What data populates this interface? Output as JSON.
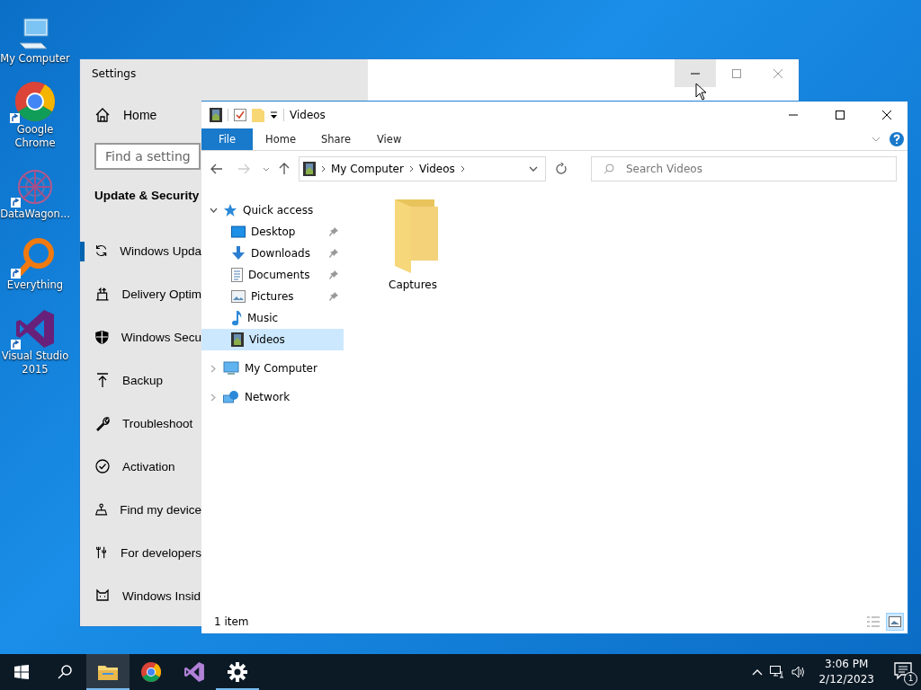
{
  "desktop_icons": [
    {
      "label": "My Computer",
      "kind": "computer",
      "shortcut": false
    },
    {
      "label": "Google Chrome",
      "kind": "chrome",
      "shortcut": true
    },
    {
      "label": "DataWagon...",
      "kind": "datawagon",
      "shortcut": true
    },
    {
      "label": "Everything",
      "kind": "everything",
      "shortcut": true
    },
    {
      "label": "Visual Studio 2015",
      "kind": "vs",
      "shortcut": true
    }
  ],
  "settings": {
    "title": "Settings",
    "minimize_hovered": true,
    "home": "Home",
    "search": {
      "placeholder": "Find a setting"
    },
    "section": "Update & Security",
    "items": [
      {
        "label": "Windows Upda",
        "kind": "sync",
        "selected": true
      },
      {
        "label": "Delivery Optim",
        "kind": "delivery",
        "selected": false
      },
      {
        "label": "Windows Secu",
        "kind": "shield",
        "selected": false
      },
      {
        "label": "Backup",
        "kind": "backup",
        "selected": false
      },
      {
        "label": "Troubleshoot",
        "kind": "wrench",
        "selected": false
      },
      {
        "label": "Activation",
        "kind": "check",
        "selected": false
      },
      {
        "label": "Find my device",
        "kind": "find",
        "selected": false
      },
      {
        "label": "For developers",
        "kind": "dev",
        "selected": false
      },
      {
        "label": "Windows Insid",
        "kind": "insider",
        "selected": false
      }
    ]
  },
  "explorer": {
    "title": "Videos",
    "ribbon_tabs": [
      {
        "label": "File",
        "selected": true
      },
      {
        "label": "Home",
        "selected": false
      },
      {
        "label": "Share",
        "selected": false
      },
      {
        "label": "View",
        "selected": false
      }
    ],
    "address": [
      "My Computer",
      "Videos"
    ],
    "search": {
      "placeholder": "Search Videos"
    },
    "nav": [
      {
        "label": "Quick access",
        "kind": "star",
        "expanded": true,
        "selected": false,
        "children": [
          {
            "label": "Desktop",
            "kind": "desktop",
            "pinned": true,
            "selected": false
          },
          {
            "label": "Downloads",
            "kind": "downloads",
            "pinned": true,
            "selected": false
          },
          {
            "label": "Documents",
            "kind": "documents",
            "pinned": true,
            "selected": false
          },
          {
            "label": "Pictures",
            "kind": "pictures",
            "pinned": true,
            "selected": false
          },
          {
            "label": "Music",
            "kind": "music",
            "pinned": false,
            "selected": false
          },
          {
            "label": "Videos",
            "kind": "videos",
            "pinned": false,
            "selected": true
          }
        ]
      },
      {
        "label": "My Computer",
        "kind": "computer",
        "expanded": false,
        "selected": false
      },
      {
        "label": "Network",
        "kind": "network",
        "expanded": false,
        "selected": false
      }
    ],
    "items": [
      {
        "label": "Captures",
        "kind": "folder"
      }
    ],
    "status": "1 item",
    "view_buttons": [
      {
        "kind": "details",
        "selected": false
      },
      {
        "kind": "large",
        "selected": true
      }
    ]
  },
  "taskbar": {
    "apps": [
      {
        "kind": "explorer",
        "active": true,
        "running": true
      },
      {
        "kind": "chrome",
        "active": false,
        "running": false
      },
      {
        "kind": "vs",
        "active": false,
        "running": false
      },
      {
        "kind": "settings",
        "active": false,
        "running": true
      }
    ],
    "time": "3:06 PM",
    "date": "2/12/2023",
    "notifications": "1"
  }
}
